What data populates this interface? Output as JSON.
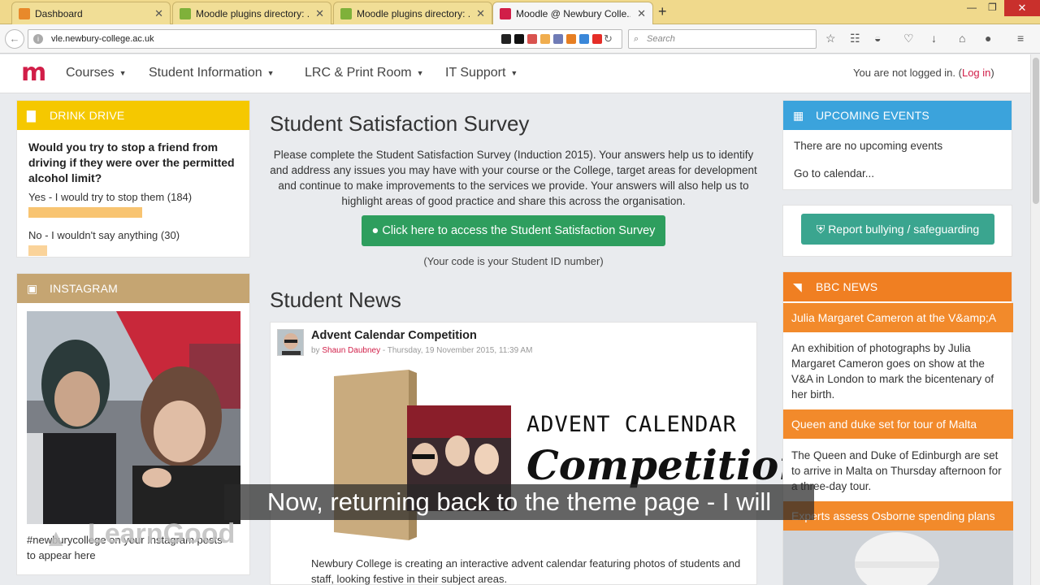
{
  "browser": {
    "tabs": [
      {
        "title": "Dashboard",
        "favicon": "moodle-hat-icon"
      },
      {
        "title": "Moodle plugins directory: ...",
        "favicon": "moodle-plugins-icon"
      },
      {
        "title": "Moodle plugins directory: ...",
        "favicon": "moodle-plugins-icon"
      },
      {
        "title": "Moodle @ Newbury Colle...",
        "favicon": "moodle-m-icon"
      }
    ],
    "close_symbol": "✕",
    "new_tab_symbol": "+",
    "url": "vle.newbury-college.ac.uk",
    "search_placeholder": "Search"
  },
  "site": {
    "logo_text": "m",
    "menu": [
      "Courses",
      "Student Information",
      "LRC & Print Room",
      "IT Support"
    ],
    "login_prefix": "You are not logged in. (",
    "login_link": "Log in",
    "login_suffix": ")"
  },
  "drink_drive": {
    "title": "DRINK DRIVE",
    "question": "Would you try to stop a friend from driving if they were over the permitted alcohol limit?",
    "options": [
      {
        "label": "Yes - I would try to stop them (184)",
        "votes": 184
      },
      {
        "label": "No - I wouldn't say anything (30)",
        "votes": 30
      }
    ]
  },
  "instagram": {
    "title": "INSTAGRAM",
    "caption": "#newburycollege on your Instagram posts to appear here"
  },
  "survey": {
    "title": "Student Satisfaction Survey",
    "text": "Please complete the Student Satisfaction Survey (Induction 2015). Your answers help us to identify and address any issues you may have with your course or the College, target areas for development and continue to make improvements to the services we provide. Your answers will also help us to highlight areas of good practice and share this across the organisation.",
    "button": "Click here to access the Student Satisfaction Survey",
    "note": "(Your code is your Student ID number)"
  },
  "news": {
    "section_title": "Student News",
    "post_title": "Advent Calendar Competition",
    "by": "by ",
    "author": "Shaun Daubney",
    "date": " - Thursday, 19 November 2015, 11:39 AM",
    "image_heading": "ADVENT CALENDAR",
    "image_script": "Competition",
    "body": "Newbury College is creating an interactive advent calendar featuring photos of students and staff, looking festive in their subject areas."
  },
  "events": {
    "title": "UPCOMING EVENTS",
    "empty": "There are no upcoming events",
    "link": "Go to calendar..."
  },
  "bullying": {
    "button": "Report bullying / safeguarding"
  },
  "bbc": {
    "title": "BBC NEWS",
    "items": [
      {
        "headline": "Julia Margaret Cameron at the V&amp;A",
        "desc": "An exhibition of photographs by Julia Margaret Cameron goes on show at the V&A in London to mark the bicentenary of her birth."
      },
      {
        "headline": "Queen and duke set for tour of Malta",
        "desc": "The Queen and Duke of Edinburgh are set to arrive in Malta on Thursday afternoon for a three-day tour."
      },
      {
        "headline": "Experts assess Osborne spending plans",
        "desc": ""
      }
    ]
  },
  "overlay": {
    "watermark": "LearnGood",
    "subtitle": "Now, returning back to the theme page - I will"
  },
  "colors": {
    "drink_header": "#f5c800",
    "instagram_header": "#c5a572",
    "events_header": "#3ba3dc",
    "bbc_header": "#f07f22",
    "bbc_item": "#f28a2b",
    "survey_button": "#2e9e5e",
    "bullying_button": "#3aa58f",
    "brand": "#d11e48"
  }
}
